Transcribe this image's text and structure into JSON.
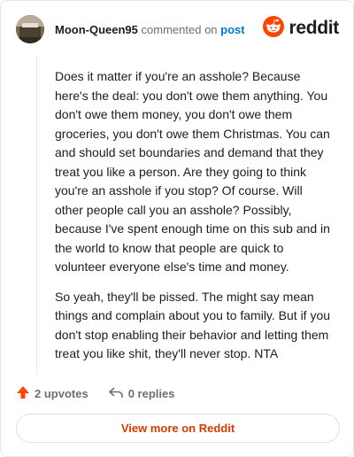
{
  "header": {
    "author": "Moon-Queen95",
    "verb": "commented on",
    "link_label": "post",
    "brand": "reddit"
  },
  "comment": {
    "paragraphs": [
      "Does it matter if you're an asshole? Because here's the deal: you don't owe them anything. You don't owe them money, you don't owe them groceries, you don't owe them Christmas. You can and should set boundaries and demand that they treat you like a person. Are they going to think you're an asshole if you stop? Of course. Will other people call you an asshole? Possibly, because I've spent enough time on this sub and in the world to know that people are quick to volunteer everyone else's time and money.",
      "So yeah, they'll be pissed. The might say mean things and complain about you to family. But if you don't stop enabling their behavior and letting them treat you like shit, they'll never stop. NTA"
    ]
  },
  "actions": {
    "upvotes": "2 upvotes",
    "replies": "0 replies"
  },
  "footer": {
    "view_more": "View more on Reddit"
  },
  "colors": {
    "accent": "#ff4500",
    "link": "#0079d3",
    "view_more": "#d93a00"
  },
  "icons": [
    "avatar",
    "reddit-logo-icon",
    "upvote-arrow-icon",
    "reply-arrow-icon"
  ]
}
